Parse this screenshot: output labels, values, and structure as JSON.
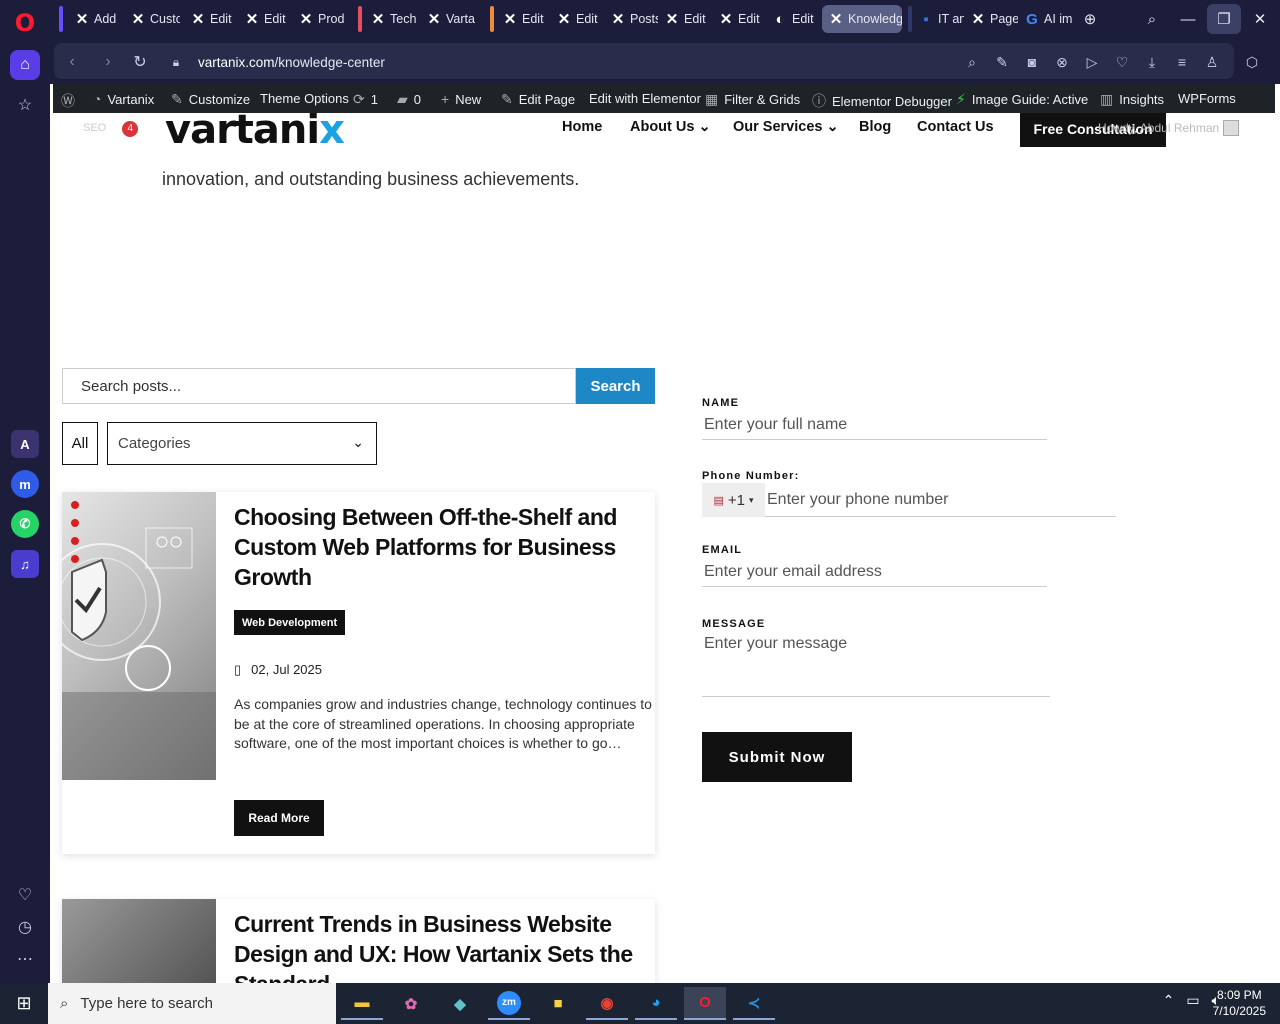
{
  "browser": {
    "tabs": [
      {
        "label": "Add"
      },
      {
        "label": "Custo"
      },
      {
        "label": "Edit"
      },
      {
        "label": "Edit"
      },
      {
        "label": "Prod"
      },
      {
        "label": "Tech"
      },
      {
        "label": "Varta"
      },
      {
        "label": "Edit"
      },
      {
        "label": "Edit"
      },
      {
        "label": "Posts"
      },
      {
        "label": "Edit"
      },
      {
        "label": "Edit"
      },
      {
        "label": "Edit"
      },
      {
        "label": "Knowledg"
      },
      {
        "label": "IT an"
      },
      {
        "label": "Page"
      },
      {
        "label": "AI im"
      }
    ],
    "url_host": "vartanix.com",
    "url_path": "/knowledge-center"
  },
  "wp_admin_bar": {
    "site_name": "Vartanix",
    "customize": "Customize",
    "theme_options": "Theme Options",
    "updates_count": "1",
    "comments_count": "0",
    "new": "New",
    "edit_page": "Edit Page",
    "edit_elementor": "Edit with Elementor",
    "filter_grids": "Filter & Grids",
    "elementor_debugger": "Elementor Debugger",
    "image_guide": "Image Guide: Active",
    "insights": "Insights",
    "wpforms": "WPForms"
  },
  "site": {
    "seo_label": "SEO",
    "seo_count": "4",
    "logo_text": "vartani",
    "logo_x": "x",
    "nav": {
      "home": "Home",
      "about": "About Us",
      "services": "Our Services",
      "blog": "Blog",
      "contact": "Contact Us"
    },
    "cta": "Free Consultation",
    "howdy": "Howdy, Abdul Rehman",
    "hero_text": "innovation, and outstanding business achievements."
  },
  "blog": {
    "search_placeholder": "Search posts...",
    "search_button": "Search",
    "filter_all": "All",
    "categories_label": "Categories",
    "posts": [
      {
        "title": "Choosing Between Off-the-Shelf and Custom Web Platforms for Business Growth",
        "category": "Web Development",
        "date": "02, Jul 2025",
        "excerpt": "As companies grow and industries change, technology continues to be at the core of streamlined operations. In choosing appropriate software, one of the most important choices is whether to go…",
        "read_more": "Read More"
      },
      {
        "title": "Current Trends in Business Website Design and UX: How Vartanix Sets the Standard"
      }
    ]
  },
  "contact_form": {
    "name_label": "NAME",
    "name_placeholder": "Enter your full name",
    "phone_label": "Phone Number:",
    "phone_code": "+1",
    "phone_placeholder": "Enter your phone number",
    "email_label": "EMAIL",
    "email_placeholder": "Enter your email address",
    "message_label": "MESSAGE",
    "message_placeholder": "Enter your message",
    "submit": "Submit Now"
  },
  "taskbar": {
    "search_placeholder": "Type here to search",
    "time": "8:09 PM",
    "date": "7/10/2025"
  },
  "colors": {
    "opera_bg": "#1b1d3a",
    "wp_bar": "#1d2327",
    "accent_blue": "#1e88c6",
    "brand_x": "#1aa3e0"
  }
}
